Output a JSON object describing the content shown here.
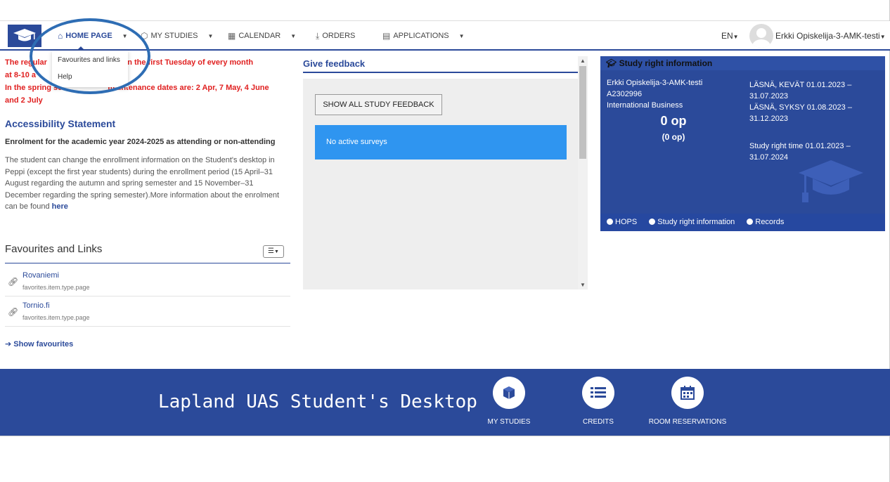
{
  "nav": {
    "home": "HOME PAGE",
    "my_studies": "MY STUDIES",
    "calendar": "CALENDAR",
    "orders": "ORDERS",
    "applications": "APPLICATIONS",
    "language": "EN",
    "user": "Erkki Opiskelija-3-AMK-testi"
  },
  "dropdown": {
    "items": [
      "Favourites and links",
      "Help"
    ]
  },
  "left": {
    "notice_line1": "The regular",
    "notice_line1b": "breaks on the first Tuesday of every month",
    "notice_line2": "at 8-10 a",
    "notice_line3": "In the spring se",
    "notice_line3b": "maintenance dates are: 2 Apr, 7 May, 4 June",
    "notice_line4": "and 2 July",
    "accessibility": "Accessibility Statement",
    "enrol_title": "Enrolment for the academic year 2024-2025 as attending or non-attending",
    "enrol_text": "The student can change the enrollment information on the Student's desktop in Peppi (except the first year students) during the enrollment period (15 April–31 August regarding the autumn and spring semester and 15 November–31 December regarding the spring semester).More information about the enrolment can be found ",
    "enrol_link": "here"
  },
  "favourites": {
    "title": "Favourites and Links",
    "items": [
      {
        "name": "Rovaniemi",
        "type": "favorites.item.type.page"
      },
      {
        "name": "Tornio.fi",
        "type": "favorites.item.type.page"
      }
    ],
    "show": "Show favourites"
  },
  "feedback": {
    "title": "Give feedback",
    "button": "SHOW ALL STUDY FEEDBACK",
    "status": "No active surveys"
  },
  "study_right": {
    "title": "Study right information",
    "name": "Erkki Opiskelija-3-AMK-testi",
    "id": "A2302996",
    "program": "International Business",
    "credits": "0 op",
    "credits_sub": "(0 op)",
    "period1": "LÄSNÄ, KEVÄT 01.01.2023 – 31.07.2023",
    "period2": "LÄSNÄ, SYKSY 01.08.2023 – 31.12.2023",
    "study_time": "Study right time 01.01.2023 – 31.07.2024",
    "links": [
      "HOPS",
      "Study right information",
      "Records"
    ]
  },
  "footer": {
    "title": "Lapland UAS Student's Desktop",
    "icons": [
      "MY STUDIES",
      "CREDITS",
      "ROOM RESERVATIONS"
    ]
  },
  "colors": {
    "brand": "#2b4a9a",
    "notice": "#e02020",
    "survey_box": "#2f95f0"
  }
}
